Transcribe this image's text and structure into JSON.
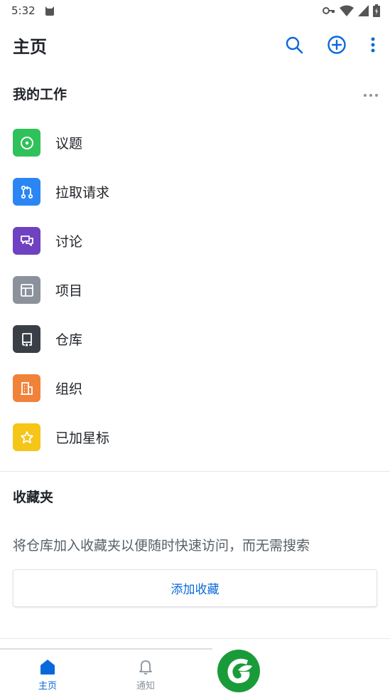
{
  "status_bar": {
    "time": "5:32",
    "icons": [
      "cat-icon",
      "key-icon",
      "wifi-icon",
      "signal-icon",
      "battery-icon"
    ]
  },
  "app_bar": {
    "title": "主页",
    "actions": [
      "search-icon",
      "add-circle-icon",
      "more-vertical-icon"
    ]
  },
  "my_work": {
    "title": "我的工作",
    "items": [
      {
        "label": "议题",
        "icon": "issue-icon",
        "color": "#2fc15a"
      },
      {
        "label": "拉取请求",
        "icon": "pull-request-icon",
        "color": "#2b86f4"
      },
      {
        "label": "讨论",
        "icon": "discussion-icon",
        "color": "#6f42c1"
      },
      {
        "label": "项目",
        "icon": "project-icon",
        "color": "#8b929c"
      },
      {
        "label": "仓库",
        "icon": "repo-icon",
        "color": "#3a3f47"
      },
      {
        "label": "组织",
        "icon": "organization-icon",
        "color": "#f0823a"
      },
      {
        "label": "已加星标",
        "icon": "star-icon",
        "color": "#f5c518"
      }
    ]
  },
  "favorites": {
    "title": "收藏夹",
    "description": "将仓库加入收藏夹以便随时快速访问，而无需搜索",
    "add_button": "添加收藏"
  },
  "bottom_nav": {
    "items": [
      {
        "label": "主页",
        "icon": "home-icon",
        "active": true
      },
      {
        "label": "通知",
        "icon": "bell-icon",
        "active": false
      }
    ]
  },
  "colors": {
    "accent": "#0969da",
    "watermark": "#1a9b3a"
  }
}
